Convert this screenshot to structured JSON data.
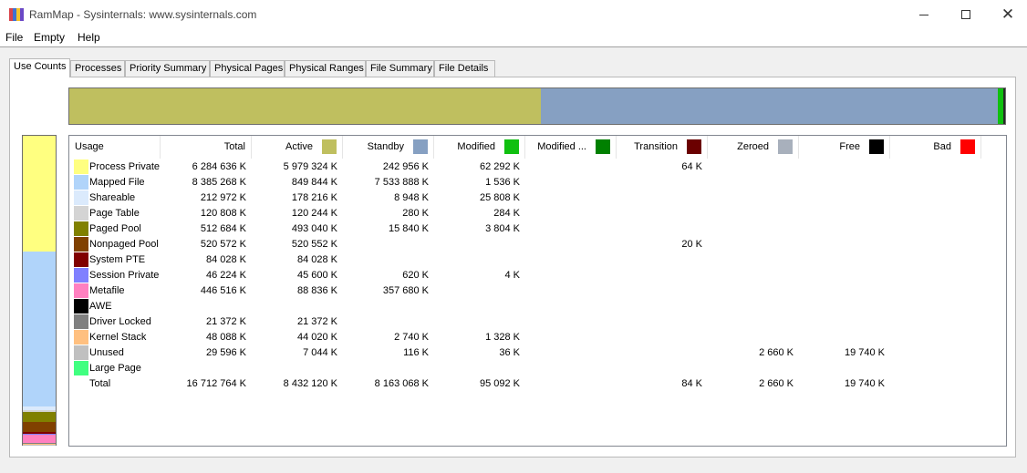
{
  "window": {
    "title": "RamMap - Sysinternals: www.sysinternals.com"
  },
  "app_icon_colors": [
    "#d9434b",
    "#3f72d0",
    "#f4c22b",
    "#6a48c6"
  ],
  "menu": [
    "File",
    "Empty",
    "Help"
  ],
  "tabs": [
    "Use Counts",
    "Processes",
    "Priority Summary",
    "Physical Pages",
    "Physical Ranges",
    "File Summary",
    "File Details"
  ],
  "active_tab": "Use Counts",
  "summary_bar": {
    "segments": [
      {
        "name": "Active",
        "color": "#bfbf5f",
        "fraction": 0.504
      },
      {
        "name": "Standby",
        "color": "#86a0c2",
        "fraction": 0.488
      },
      {
        "name": "Modified",
        "color": "#10c010",
        "fraction": 0.006
      },
      {
        "name": "Other",
        "color": "#2a2a2a",
        "fraction": 0.002
      }
    ]
  },
  "usage_bar": {
    "segments": [
      {
        "name": "Process Private",
        "color": "#ffff80",
        "fraction": 0.376
      },
      {
        "name": "Mapped File",
        "color": "#b0d4fa",
        "fraction": 0.502
      },
      {
        "name": "Shareable",
        "color": "#dbeafc",
        "fraction": 0.013
      },
      {
        "name": "Page Table",
        "color": "#d4d4d4",
        "fraction": 0.007
      },
      {
        "name": "Paged Pool",
        "color": "#808000",
        "fraction": 0.031
      },
      {
        "name": "Nonpaged Pool",
        "color": "#804000",
        "fraction": 0.031
      },
      {
        "name": "System PTE",
        "color": "#800000",
        "fraction": 0.005
      },
      {
        "name": "Session Private",
        "color": "#8080ff",
        "fraction": 0.003
      },
      {
        "name": "Metafile",
        "color": "#ff80c0",
        "fraction": 0.027
      },
      {
        "name": "Driver Locked",
        "color": "#808080",
        "fraction": 0.001
      },
      {
        "name": "Kernel Stack",
        "color": "#ffc080",
        "fraction": 0.003
      },
      {
        "name": "Unused",
        "color": "#c0c0c0",
        "fraction": 0.002
      }
    ]
  },
  "columns": [
    {
      "label": "Usage",
      "color": null
    },
    {
      "label": "Total",
      "color": null
    },
    {
      "label": "Active",
      "color": "#bfbf5f"
    },
    {
      "label": "Standby",
      "color": "#86a0c2"
    },
    {
      "label": "Modified",
      "color": "#10c010"
    },
    {
      "label": "Modified ...",
      "color": "#008000"
    },
    {
      "label": "Transition",
      "color": "#6b0000"
    },
    {
      "label": "Zeroed",
      "color": "#a8b0bc"
    },
    {
      "label": "Free",
      "color": "#000000"
    },
    {
      "label": "Bad",
      "color": "#ff0000"
    }
  ],
  "rows": [
    {
      "usage": "Process Private",
      "color": "#ffff80",
      "values": [
        "6 284 636 K",
        "5 979 324 K",
        "242 956 K",
        "62 292 K",
        "",
        "64 K",
        "",
        "",
        ""
      ]
    },
    {
      "usage": "Mapped File",
      "color": "#b0d4fa",
      "values": [
        "8 385 268 K",
        "849 844 K",
        "7 533 888 K",
        "1 536 K",
        "",
        "",
        "",
        "",
        ""
      ]
    },
    {
      "usage": "Shareable",
      "color": "#dbeafc",
      "values": [
        "212 972 K",
        "178 216 K",
        "8 948 K",
        "25 808 K",
        "",
        "",
        "",
        "",
        ""
      ]
    },
    {
      "usage": "Page Table",
      "color": "#d4d4d4",
      "values": [
        "120 808 K",
        "120 244 K",
        "280 K",
        "284 K",
        "",
        "",
        "",
        "",
        ""
      ]
    },
    {
      "usage": "Paged Pool",
      "color": "#808000",
      "values": [
        "512 684 K",
        "493 040 K",
        "15 840 K",
        "3 804 K",
        "",
        "",
        "",
        "",
        ""
      ]
    },
    {
      "usage": "Nonpaged Pool",
      "color": "#804000",
      "values": [
        "520 572 K",
        "520 552 K",
        "",
        "",
        "",
        "20 K",
        "",
        "",
        ""
      ]
    },
    {
      "usage": "System PTE",
      "color": "#800000",
      "values": [
        "84 028 K",
        "84 028 K",
        "",
        "",
        "",
        "",
        "",
        "",
        ""
      ]
    },
    {
      "usage": "Session Private",
      "color": "#8080ff",
      "values": [
        "46 224 K",
        "45 600 K",
        "620 K",
        "4 K",
        "",
        "",
        "",
        "",
        ""
      ]
    },
    {
      "usage": "Metafile",
      "color": "#ff80c0",
      "values": [
        "446 516 K",
        "88 836 K",
        "357 680 K",
        "",
        "",
        "",
        "",
        "",
        ""
      ]
    },
    {
      "usage": "AWE",
      "color": "#000000",
      "values": [
        "",
        "",
        "",
        "",
        "",
        "",
        "",
        "",
        ""
      ]
    },
    {
      "usage": "Driver Locked",
      "color": "#808080",
      "values": [
        "21 372 K",
        "21 372 K",
        "",
        "",
        "",
        "",
        "",
        "",
        ""
      ]
    },
    {
      "usage": "Kernel Stack",
      "color": "#ffc080",
      "values": [
        "48 088 K",
        "44 020 K",
        "2 740 K",
        "1 328 K",
        "",
        "",
        "",
        "",
        ""
      ]
    },
    {
      "usage": "Unused",
      "color": "#c0c0c0",
      "values": [
        "29 596 K",
        "7 044 K",
        "116 K",
        "36 K",
        "",
        "",
        "2 660 K",
        "19 740 K",
        ""
      ]
    },
    {
      "usage": "Large Page",
      "color": "#40ff80",
      "values": [
        "",
        "",
        "",
        "",
        "",
        "",
        "",
        "",
        ""
      ]
    },
    {
      "usage": "Total",
      "color": null,
      "values": [
        "16 712 764 K",
        "8 432 120 K",
        "8 163 068 K",
        "95 092 K",
        "",
        "84 K",
        "2 660 K",
        "19 740 K",
        ""
      ]
    }
  ]
}
